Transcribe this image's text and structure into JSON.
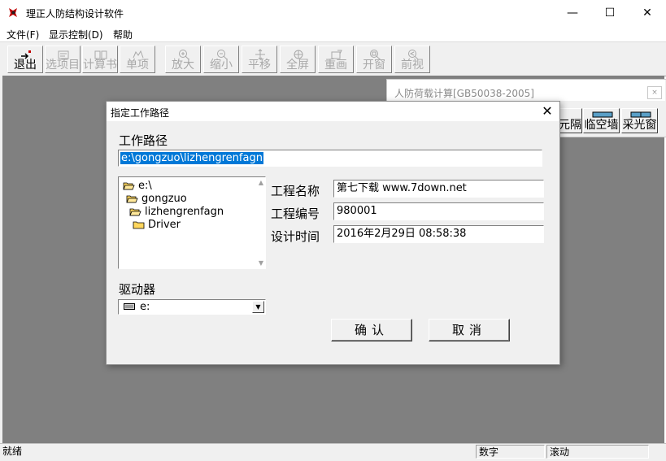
{
  "window": {
    "title": "理正人防结构设计软件",
    "minimize_glyph": "—",
    "maximize_glyph": "☐",
    "close_glyph": "✕"
  },
  "menu": {
    "items": [
      "文件(F)",
      "显示控制(D)",
      "帮助"
    ]
  },
  "toolbar": {
    "buttons": [
      {
        "label": "退出",
        "icon": "exit-icon",
        "enabled": true
      },
      {
        "label": "选项目",
        "icon": "select-project-icon",
        "enabled": false
      },
      {
        "label": "计算书",
        "icon": "report-icon",
        "enabled": false
      },
      {
        "label": "单项",
        "icon": "single-item-icon",
        "enabled": false
      },
      {
        "label": "放大",
        "icon": "zoom-in-icon",
        "enabled": false
      },
      {
        "label": "缩小",
        "icon": "zoom-out-icon",
        "enabled": false
      },
      {
        "label": "平移",
        "icon": "pan-icon",
        "enabled": false
      },
      {
        "label": "全屏",
        "icon": "fullscreen-icon",
        "enabled": false
      },
      {
        "label": "重画",
        "icon": "redraw-icon",
        "enabled": false
      },
      {
        "label": "开窗",
        "icon": "open-window-icon",
        "enabled": false
      },
      {
        "label": "前视",
        "icon": "previous-view-icon",
        "enabled": false
      }
    ]
  },
  "child_window": {
    "title": "人防荷载计算[GB50038-2005]",
    "close_glyph": "×",
    "buttons": [
      "元隔",
      "临空墙",
      "采光窗"
    ]
  },
  "dialog": {
    "title": "指定工作路径",
    "close_glyph": "✕",
    "path_label": "工作路径",
    "path_value": "e:\\gongzuo\\lizhengrenfagn",
    "tree": [
      "e:\\",
      "gongzuo",
      "lizhengrenfagn",
      "Driver"
    ],
    "project_name_label": "工程名称",
    "project_name_value": "第七下载 www.7down.net",
    "project_no_label": "工程编号",
    "project_no_value": "980001",
    "design_time_label": "设计时间",
    "design_time_value": "2016年2月29日 08:58:38",
    "drive_label": "驱动器",
    "drive_value": "e:",
    "ok_label": "确认",
    "cancel_label": "取消"
  },
  "status": {
    "ready": "就绪",
    "num": "数字",
    "scroll": "滚动"
  },
  "colors": {
    "selection": "#0078d7",
    "mdi_background": "#808080",
    "folder": "#ffd75e"
  }
}
